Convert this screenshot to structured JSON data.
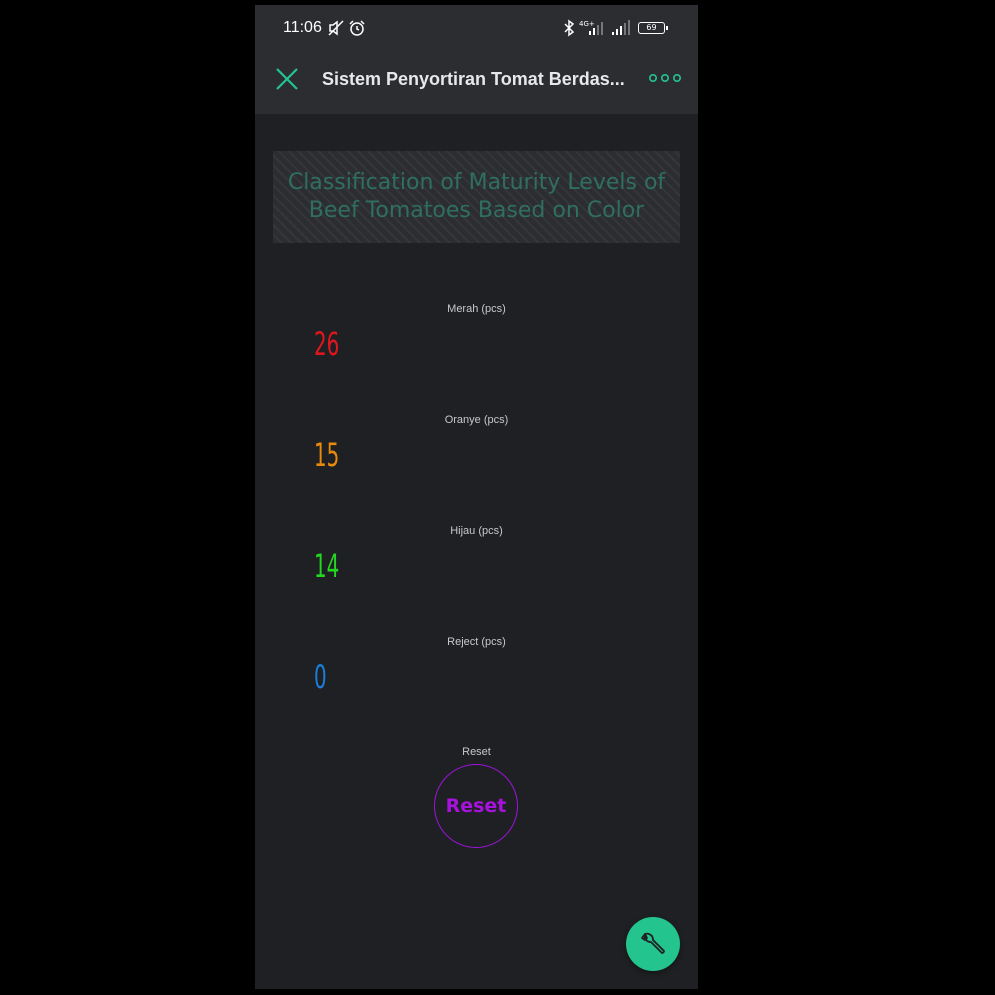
{
  "status_bar": {
    "time": "11:06",
    "battery": "69",
    "icons": [
      "muted-icon",
      "alarm-icon",
      "bluetooth-icon",
      "signal-4g-icon",
      "signal-icon",
      "battery-icon"
    ]
  },
  "app_bar": {
    "title": "Sistem Penyortiran Tomat Berdas...",
    "close_icon": "close-icon",
    "more_icon": "more-icon"
  },
  "banner": {
    "text": "Classification of Maturity Levels of Beef Tomatoes Based on Color"
  },
  "counters": [
    {
      "label": "Merah (pcs)",
      "value": "26",
      "color": "#e0161d"
    },
    {
      "label": "Oranye (pcs)",
      "value": "15",
      "color": "#ea8a0c"
    },
    {
      "label": "Hijau (pcs)",
      "value": "14",
      "color": "#23d81f"
    },
    {
      "label": "Reject (pcs)",
      "value": "0",
      "color": "#1a7fdc"
    }
  ],
  "reset": {
    "label": "Reset",
    "button_text": "Reset",
    "color": "#a712de"
  },
  "fab": {
    "icon": "wrench-icon",
    "color": "#23c48e"
  }
}
